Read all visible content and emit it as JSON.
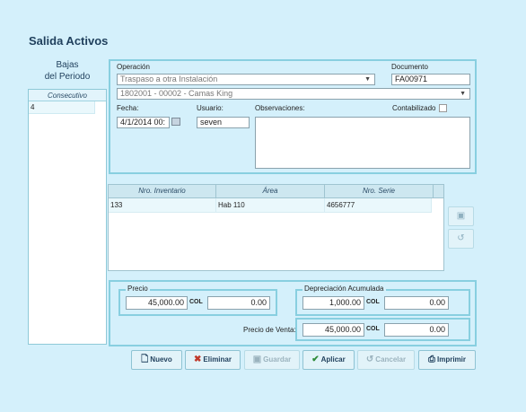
{
  "title": "Salida Activos",
  "left": {
    "heading_line1": "Bajas",
    "heading_line2": "del Periodo",
    "column_header": "Consecutivo",
    "rows": [
      "4"
    ]
  },
  "form": {
    "operacion_label": "Operación",
    "operacion_value": "Traspaso a otra Instalación",
    "instalacion_value": "1802001 - 00002 - Camas King",
    "documento_label": "Documento",
    "documento_value": "FA00971",
    "fecha_label": "Fecha:",
    "fecha_value": "4/1/2014 00:",
    "usuario_label": "Usuario:",
    "usuario_value": "seven",
    "observaciones_label": "Observaciones:",
    "observaciones_value": "",
    "contabilizado_label": "Contabilizado",
    "contabilizado_checked": false
  },
  "grid": {
    "headers": [
      "Nro. Inventario",
      "Área",
      "Nro. Serie"
    ],
    "rows": [
      [
        "133",
        "Hab 110",
        "4656777"
      ]
    ]
  },
  "side_buttons": {
    "save_icon": "floppy-disk-icon",
    "undo_icon": "undo-arrow-icon"
  },
  "pricing": {
    "precio_label": "Precio",
    "precio_value": "45,000.00",
    "precio_currency": "COL",
    "precio_secondary": "0.00",
    "depreciacion_label": "Depreciación Acumulada",
    "depreciacion_value": "1,000.00",
    "depreciacion_currency": "COL",
    "depreciacion_secondary": "0.00",
    "venta_label": "Precio de Venta:",
    "venta_value": "45,000.00",
    "venta_currency": "COL",
    "venta_secondary": "0.00"
  },
  "toolbar": {
    "nuevo": "Nuevo",
    "eliminar": "Eliminar",
    "guardar": "Guardar",
    "aplicar": "Aplicar",
    "cancelar": "Cancelar",
    "imprimir": "Imprimir"
  }
}
